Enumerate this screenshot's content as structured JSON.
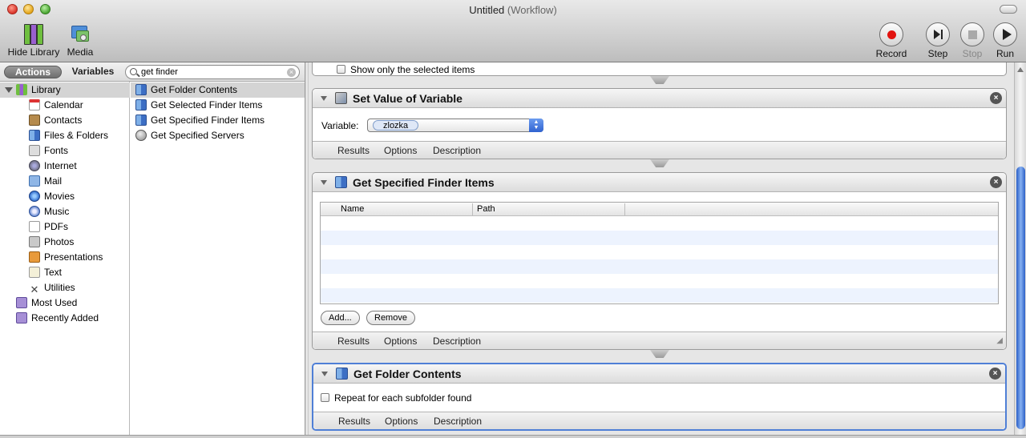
{
  "window": {
    "title": "Untitled",
    "subtitle": "(Workflow)"
  },
  "toolbar": {
    "hide_library": "Hide Library",
    "media": "Media",
    "record": "Record",
    "step": "Step",
    "stop": "Stop",
    "run": "Run"
  },
  "library": {
    "tabs": {
      "actions": "Actions",
      "variables": "Variables"
    },
    "search": {
      "value": "get finder"
    },
    "root": "Library",
    "items": [
      "Calendar",
      "Contacts",
      "Files & Folders",
      "Fonts",
      "Internet",
      "Mail",
      "Movies",
      "Music",
      "PDFs",
      "Photos",
      "Presentations",
      "Text",
      "Utilities"
    ],
    "groups": [
      "Most Used",
      "Recently Added"
    ]
  },
  "results": [
    "Get Folder Contents",
    "Get Selected Finder Items",
    "Get Specified Finder Items",
    "Get Specified Servers"
  ],
  "workflow": {
    "partial_option": "Show only the selected items",
    "footer": {
      "results": "Results",
      "options": "Options",
      "description": "Description"
    },
    "set_value": {
      "title": "Set Value of Variable",
      "variable_label": "Variable:",
      "variable_value": "zlozka"
    },
    "get_specified": {
      "title": "Get Specified Finder Items",
      "columns": [
        "Name",
        "Path"
      ],
      "add": "Add...",
      "remove": "Remove"
    },
    "get_folder": {
      "title": "Get Folder Contents",
      "repeat_label": "Repeat for each subfolder found"
    }
  }
}
